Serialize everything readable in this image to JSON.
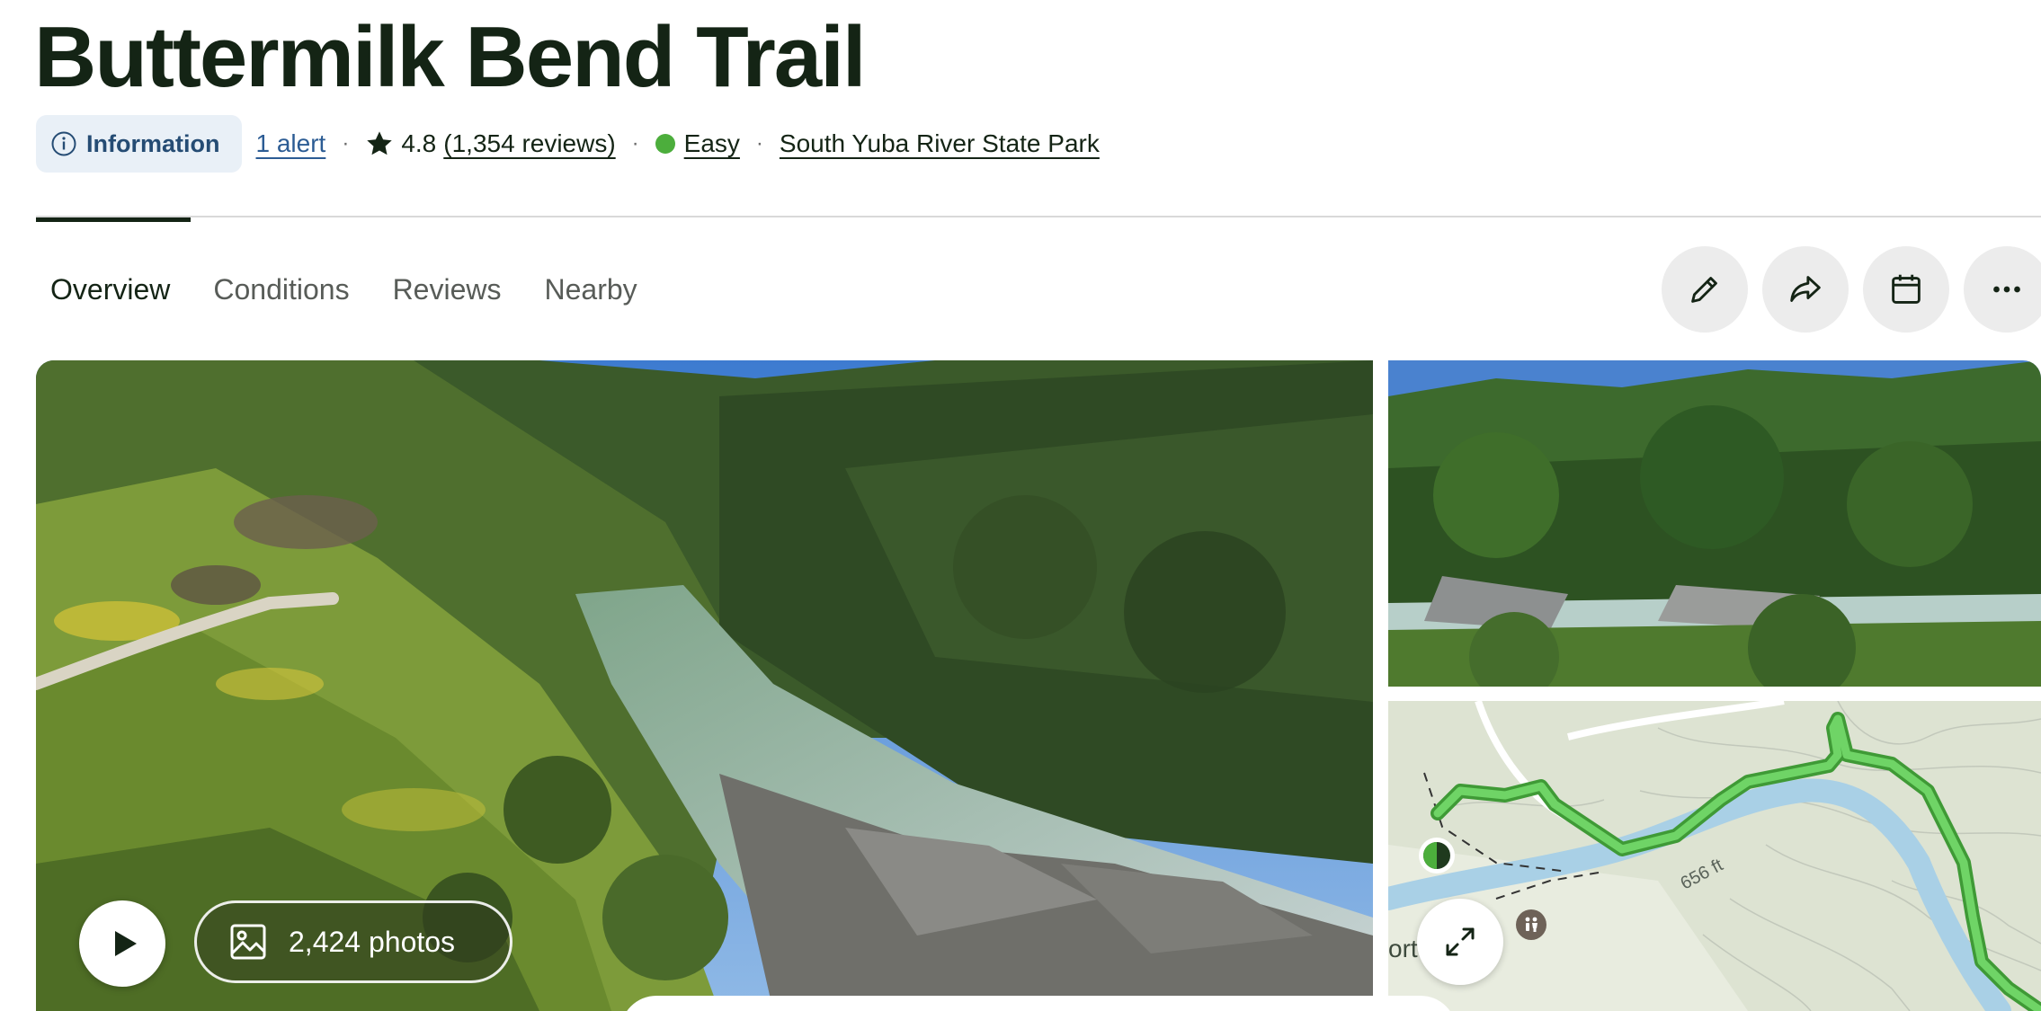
{
  "trail": {
    "title": "Buttermilk Bend Trail"
  },
  "meta": {
    "info_label": "Information",
    "alert_label": "1 alert",
    "separator": "·",
    "rating": "4.8",
    "reviews_label": "(1,354 reviews)",
    "difficulty": "Easy",
    "difficulty_color": "#4cae3c",
    "park": "South Yuba River State Park"
  },
  "tabs": [
    {
      "label": "Overview",
      "active": true
    },
    {
      "label": "Conditions",
      "active": false
    },
    {
      "label": "Reviews",
      "active": false
    },
    {
      "label": "Nearby",
      "active": false
    }
  ],
  "actions": [
    {
      "name": "edit-button",
      "icon": "pencil-icon"
    },
    {
      "name": "share-button",
      "icon": "share-arrow-icon"
    },
    {
      "name": "calendar-button",
      "icon": "calendar-icon"
    },
    {
      "name": "more-button",
      "icon": "more-dots-icon"
    }
  ],
  "gallery": {
    "photos_label": "2,424 photos"
  },
  "map": {
    "distance_label": "656 ft",
    "place_fragment": "ort",
    "trail_color": "#5fcb5a",
    "river_color": "#a9d0e6"
  },
  "colors": {
    "accent_info_bg": "#e9f0f7",
    "accent_info_text": "#254c74",
    "text_primary": "#142415"
  }
}
